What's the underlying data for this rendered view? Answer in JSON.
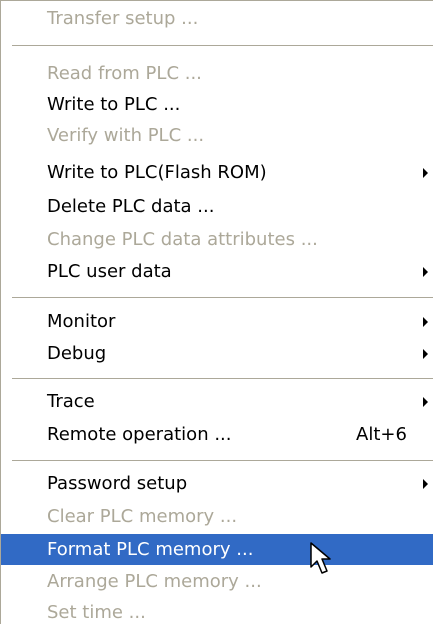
{
  "menu": {
    "items": [
      {
        "label": "Transfer setup ...",
        "disabled": true
      },
      {
        "label": "Read from PLC ...",
        "disabled": true
      },
      {
        "label": "Write to PLC ...",
        "disabled": false
      },
      {
        "label": "Verify with PLC ...",
        "disabled": true
      },
      {
        "label": "Write to PLC(Flash ROM)",
        "disabled": false,
        "submenu": true
      },
      {
        "label": "Delete PLC data ...",
        "disabled": false
      },
      {
        "label": "Change PLC data attributes ...",
        "disabled": true
      },
      {
        "label": "PLC user data",
        "disabled": false,
        "submenu": true
      },
      {
        "label": "Monitor",
        "disabled": false,
        "submenu": true
      },
      {
        "label": "Debug",
        "disabled": false,
        "submenu": true
      },
      {
        "label": "Trace",
        "disabled": false,
        "submenu": true
      },
      {
        "label": "Remote operation ...",
        "disabled": false,
        "shortcut": "Alt+6"
      },
      {
        "label": "Password setup",
        "disabled": false,
        "submenu": true
      },
      {
        "label": "Clear PLC memory ...",
        "disabled": true
      },
      {
        "label": "Format PLC memory ...",
        "disabled": false,
        "selected": true
      },
      {
        "label": "Arrange PLC memory ...",
        "disabled": true
      },
      {
        "label": "Set time ...",
        "disabled": true
      }
    ]
  },
  "colors": {
    "disabled_text": "#aca899",
    "selection_background": "#316ac5",
    "selection_text": "#ffffff",
    "separator": "#aca899"
  },
  "icons": {
    "submenu_arrow": "chevron-right-icon",
    "pointer": "mouse-pointer-icon"
  }
}
